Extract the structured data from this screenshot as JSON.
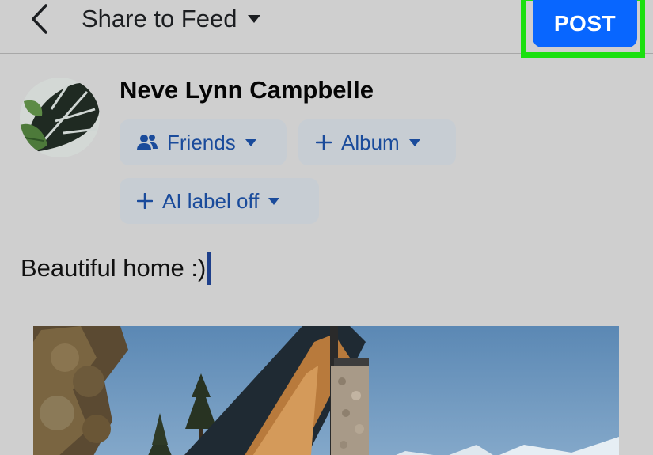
{
  "header": {
    "back_icon": "chevron-left-icon",
    "share_label": "Share to Feed",
    "share_dropdown_icon": "caret-down-icon",
    "post_label": "POST",
    "colors": {
      "post_button": "#0866ff",
      "highlight": "#1be00f"
    }
  },
  "composer": {
    "user_name": "Neve Lynn Campbelle",
    "audience": {
      "icon": "friends-icon",
      "label": "Friends",
      "dropdown_icon": "caret-down-icon"
    },
    "album": {
      "icon": "plus-icon",
      "label": "Album",
      "dropdown_icon": "caret-down-icon"
    },
    "ai_label": {
      "icon": "plus-icon",
      "label": "AI label off",
      "dropdown_icon": "caret-down-icon"
    },
    "post_text": "Beautiful home :)",
    "accent_color": "#1a4b9b"
  },
  "attachment": {
    "type": "photo",
    "subject": "modern-house-photo"
  }
}
